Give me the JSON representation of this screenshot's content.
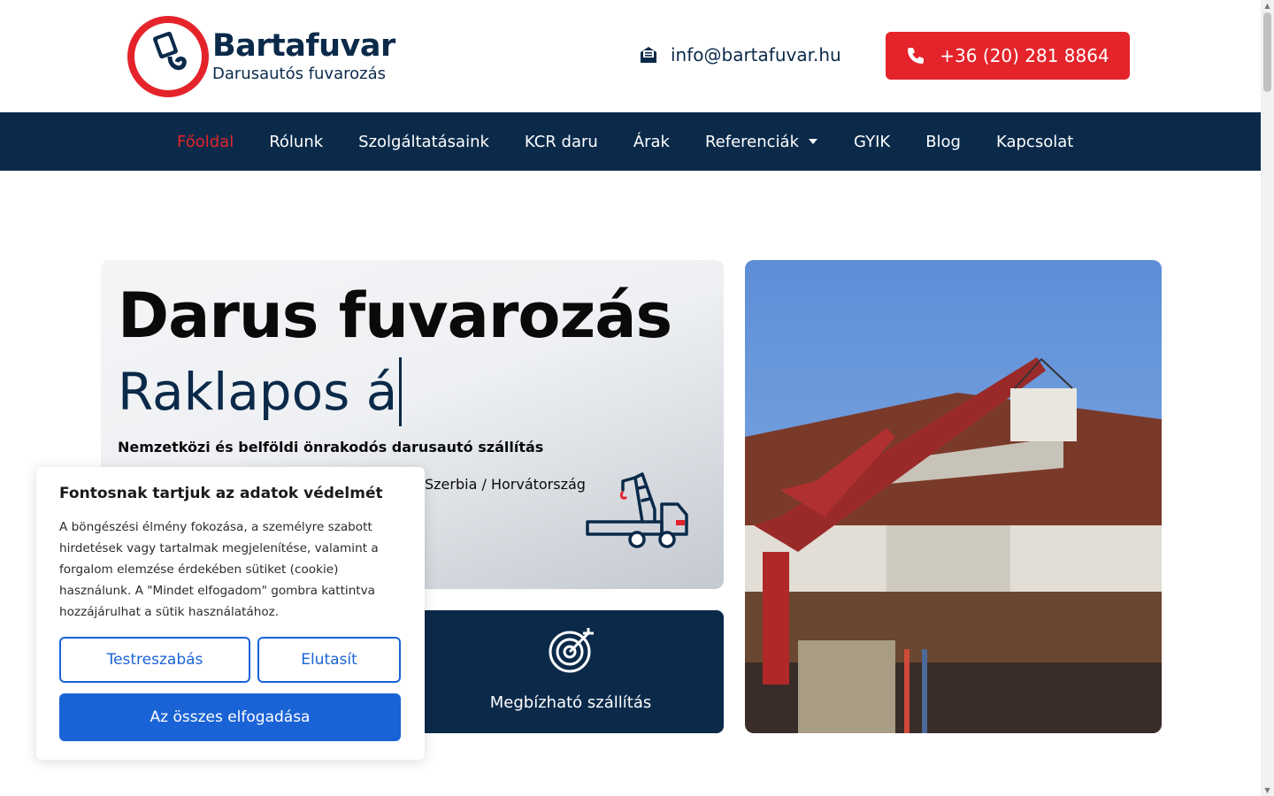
{
  "header": {
    "logo_name": "Bartafuvar",
    "logo_tagline": "Darusautós fuvarozás",
    "email": "info@bartafuvar.hu",
    "phone": "+36 (20) 281 8864"
  },
  "nav": {
    "items": [
      {
        "label": "Főoldal",
        "active": true
      },
      {
        "label": "Rólunk"
      },
      {
        "label": "Szolgáltatásaink"
      },
      {
        "label": "KCR daru"
      },
      {
        "label": "Árak"
      },
      {
        "label": "Referenciák",
        "has_dropdown": true
      },
      {
        "label": "GYIK"
      },
      {
        "label": "Blog"
      },
      {
        "label": "Kapcsolat"
      }
    ]
  },
  "hero": {
    "title": "Darus fuvarozás",
    "typed_text": "Raklapos á",
    "description": "Nemzetközi és belföldi önrakodós darusautó szállítás",
    "countries_visible": "Szerbia / Horvátország"
  },
  "feature": {
    "label": "Megbízható szállítás"
  },
  "cookie": {
    "title": "Fontosnak tartjuk az adatok védelmét",
    "text": "A böngészési élmény fokozása, a személyre szabott hirdetések vagy tartalmak megjelenítése, valamint a forgalom elemzése érdekében sütiket (cookie) használunk. A \"Mindet elfogadom\" gombra kattintva hozzájárulhat a sütik használatához.",
    "customize_label": "Testreszabás",
    "reject_label": "Elutasít",
    "accept_label": "Az összes elfogadása"
  },
  "colors": {
    "brand_navy": "#0b2a4a",
    "brand_red": "#e4232b",
    "cookie_blue": "#1a63d6"
  },
  "icons": [
    "envelope-icon",
    "phone-icon",
    "chevron-down-icon",
    "crane-truck-icon",
    "target-icon"
  ]
}
